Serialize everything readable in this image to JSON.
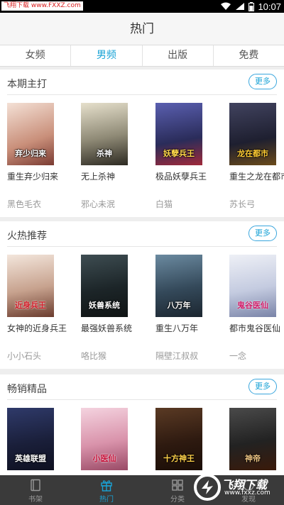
{
  "status": {
    "watermark": "飞翔下载 www.FXXZ.com",
    "time": "10:07"
  },
  "header": {
    "title": "热门"
  },
  "tabs": [
    {
      "label": "女频",
      "active": false
    },
    {
      "label": "男频",
      "active": true
    },
    {
      "label": "出版",
      "active": false
    },
    {
      "label": "免费",
      "active": false
    }
  ],
  "sections": [
    {
      "title": "本期主打",
      "more": "更多",
      "books": [
        {
          "name": "重生弃少归来",
          "author": "黑色毛衣",
          "cover_text": "弃少归来",
          "color": "#e8c9b8"
        },
        {
          "name": "无上杀神",
          "author": "邪心未泯",
          "cover_text": "杀神",
          "color": "#d9d2b8"
        },
        {
          "name": "极品妖孽兵王",
          "author": "白猫",
          "cover_text": "妖孽兵王",
          "color": "#3b3f7a"
        },
        {
          "name": "重生之龙在都市",
          "author": "苏长弓",
          "cover_text": "龙在都市",
          "color": "#2d2e44"
        }
      ]
    },
    {
      "title": "火热推荐",
      "more": "更多",
      "books": [
        {
          "name": "女神的近身兵王",
          "author": "小小石头",
          "cover_text": "近身兵王",
          "color": "#ead7c9"
        },
        {
          "name": "最强妖兽系统",
          "author": "咯比猴",
          "cover_text": "妖兽系统",
          "color": "#2c3a3e"
        },
        {
          "name": "重生八万年",
          "author": "隔壁江叔叔",
          "cover_text": "八万年",
          "color": "#3c5160"
        },
        {
          "name": "都市鬼谷医仙",
          "author": "一念",
          "cover_text": "鬼谷医仙",
          "color": "#d8dde8"
        }
      ]
    },
    {
      "title": "畅销精品",
      "more": "更多",
      "books": [
        {
          "name": "",
          "author": "",
          "cover_text": "英雄联盟",
          "color": "#222a4a"
        },
        {
          "name": "",
          "author": "",
          "cover_text": "小医仙",
          "color": "#e6b7c8"
        },
        {
          "name": "",
          "author": "",
          "cover_text": "十方神王",
          "color": "#3a2418"
        },
        {
          "name": "",
          "author": "",
          "cover_text": "神帝",
          "color": "#2a2a2a"
        }
      ]
    }
  ],
  "nav": [
    {
      "label": "书架",
      "icon": "bookshelf-icon",
      "active": false
    },
    {
      "label": "热门",
      "icon": "gift-icon",
      "active": true
    },
    {
      "label": "分类",
      "icon": "grid-icon",
      "active": false
    },
    {
      "label": "发现",
      "icon": "discover-icon",
      "active": false
    }
  ],
  "watermark2": {
    "text": "飞翔下载",
    "url": "www.fxxz.com"
  },
  "accent": "#1aa3d6"
}
